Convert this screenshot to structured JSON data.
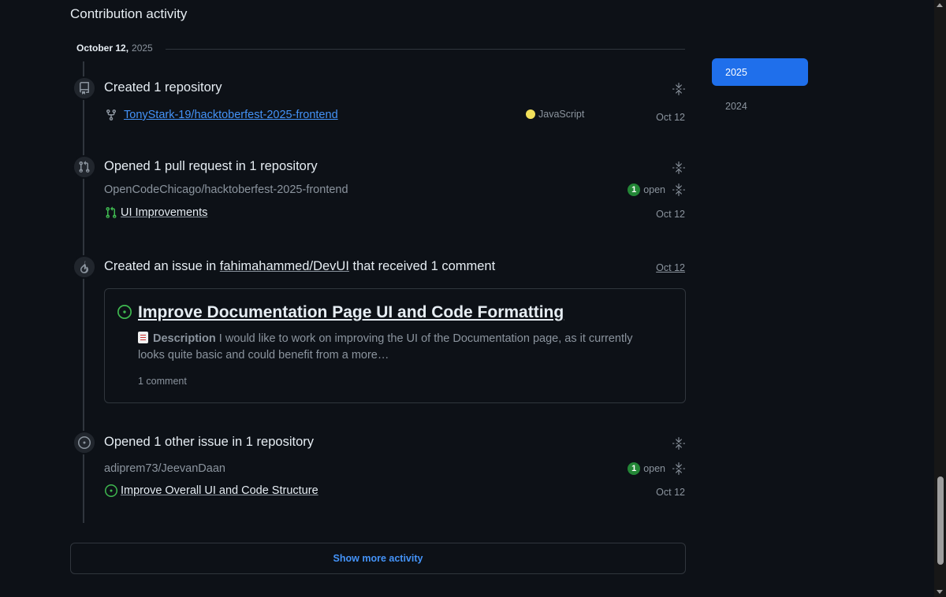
{
  "section_title": "Contribution activity",
  "date": {
    "month_day": "October 12,",
    "year": "2025"
  },
  "events": {
    "created_repo": {
      "title": "Created 1 repository",
      "repo": "TonyStark-19/hacktoberfest-2025-frontend",
      "language": "JavaScript",
      "language_color": "#f1e05a",
      "date": "Oct 12"
    },
    "pull_request": {
      "title": "Opened 1 pull request in 1 repository",
      "repo": "OpenCodeChicago/hacktoberfest-2025-frontend",
      "open_count": "1",
      "open_label": "open",
      "item": "UI Improvements",
      "date": "Oct 12"
    },
    "issue_comment": {
      "title_prefix": "Created an issue in",
      "repo": "fahimahammed/DevUI",
      "title_suffix": "that received 1 comment",
      "date": "Oct 12",
      "card": {
        "title": "Improve Documentation Page UI and Code Formatting",
        "body_label": "Description",
        "body": "I would like to work on improving the UI of the Documentation page, as it currently looks quite basic and could benefit from a more…",
        "comments": "1 comment"
      }
    },
    "other_issue": {
      "title": "Opened 1 other issue in 1 repository",
      "repo": "adiprem73/JeevanDaan",
      "open_count": "1",
      "open_label": "open",
      "item": "Improve Overall UI and Code Structure",
      "date": "Oct 12"
    }
  },
  "show_more": "Show more activity",
  "years": [
    "2025",
    "2024"
  ],
  "colors": {
    "accent": "#1f6feb",
    "link": "#4493f8",
    "open_green": "#3fb950",
    "background": "#0d1117"
  }
}
